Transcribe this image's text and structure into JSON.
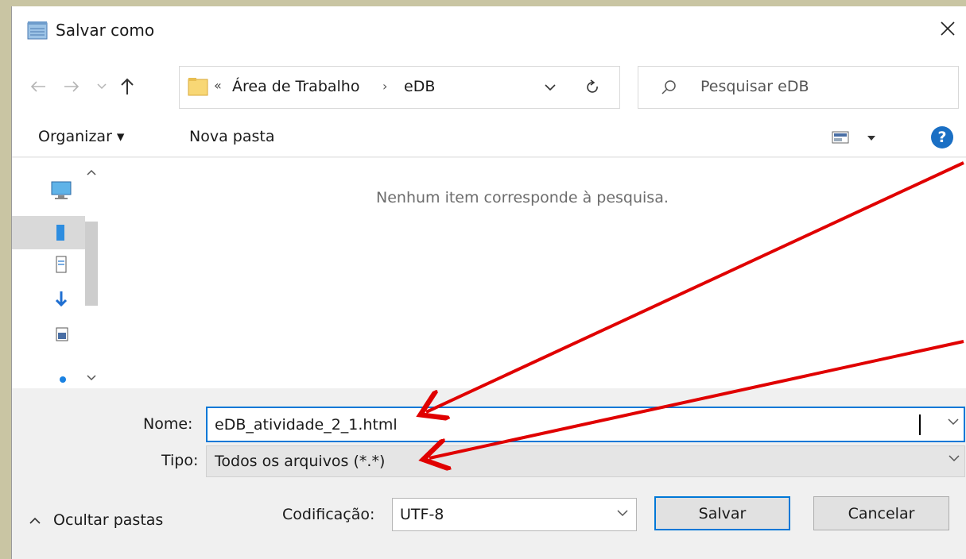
{
  "window": {
    "title": "Salvar como",
    "icon": "notepad-icon"
  },
  "address": {
    "overflow_chevrons": "«",
    "crumbs": [
      "Área de Trabalho",
      "eDB"
    ],
    "separator": "›"
  },
  "search": {
    "placeholder": "Pesquisar eDB"
  },
  "toolbar": {
    "organize_label": "Organizar ▾",
    "new_folder_label": "Nova pasta",
    "help_label": "?"
  },
  "files": {
    "empty_message": "Nenhum item corresponde à pesquisa."
  },
  "form": {
    "name_label": "Nome:",
    "name_value": "eDB_atividade_2_1.html",
    "type_label": "Tipo:",
    "type_value": "Todos os arquivos  (*.*)",
    "encoding_label": "Codificação:",
    "encoding_value": "UTF-8",
    "hide_folders_label": "Ocultar pastas",
    "save_label": "Salvar",
    "cancel_label": "Cancelar"
  },
  "colors": {
    "accent": "#0078d7",
    "annotation": "#e00000"
  }
}
